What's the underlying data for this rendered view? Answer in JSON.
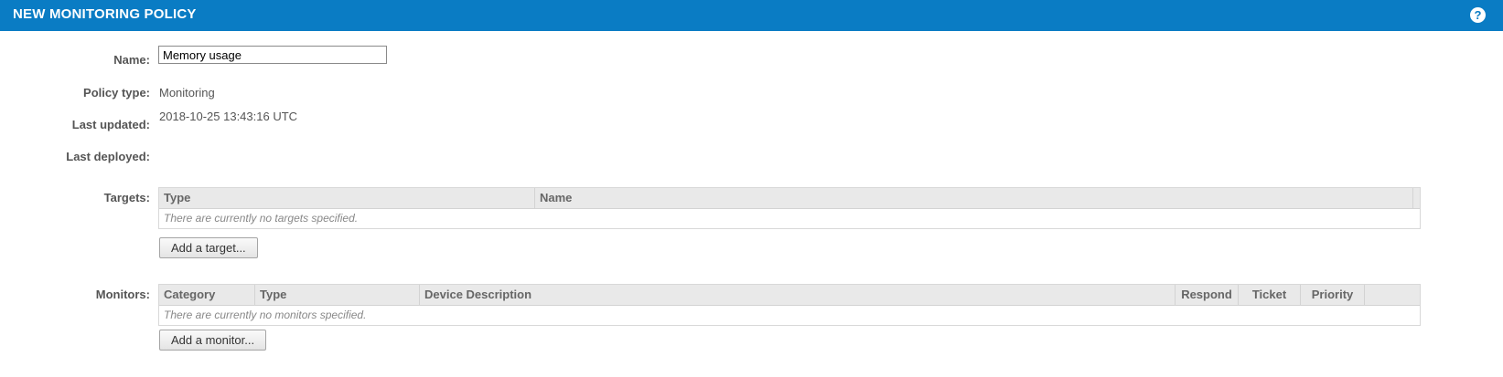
{
  "header": {
    "title": "NEW MONITORING POLICY",
    "help_symbol": "?"
  },
  "form": {
    "name_label": "Name:",
    "name_value": "Memory usage",
    "policy_type_label": "Policy type:",
    "policy_type_value": "Monitoring",
    "last_updated_label": "Last updated:",
    "last_updated_value": "2018-10-25 13:43:16 UTC",
    "last_deployed_label": "Last deployed:",
    "last_deployed_value": ""
  },
  "targets": {
    "label": "Targets:",
    "columns": [
      "Type",
      "Name"
    ],
    "empty_message": "There are currently no targets specified.",
    "add_button": "Add a target..."
  },
  "monitors": {
    "label": "Monitors:",
    "columns": [
      "Category",
      "Type",
      "Device Description",
      "Respond",
      "Ticket",
      "Priority"
    ],
    "empty_message": "There are currently no monitors specified.",
    "add_button": "Add a monitor..."
  },
  "colors": {
    "header_bg": "#0a7cc4",
    "grid_header_bg": "#e9e9e9"
  },
  "icons": {
    "help": "help-icon"
  }
}
